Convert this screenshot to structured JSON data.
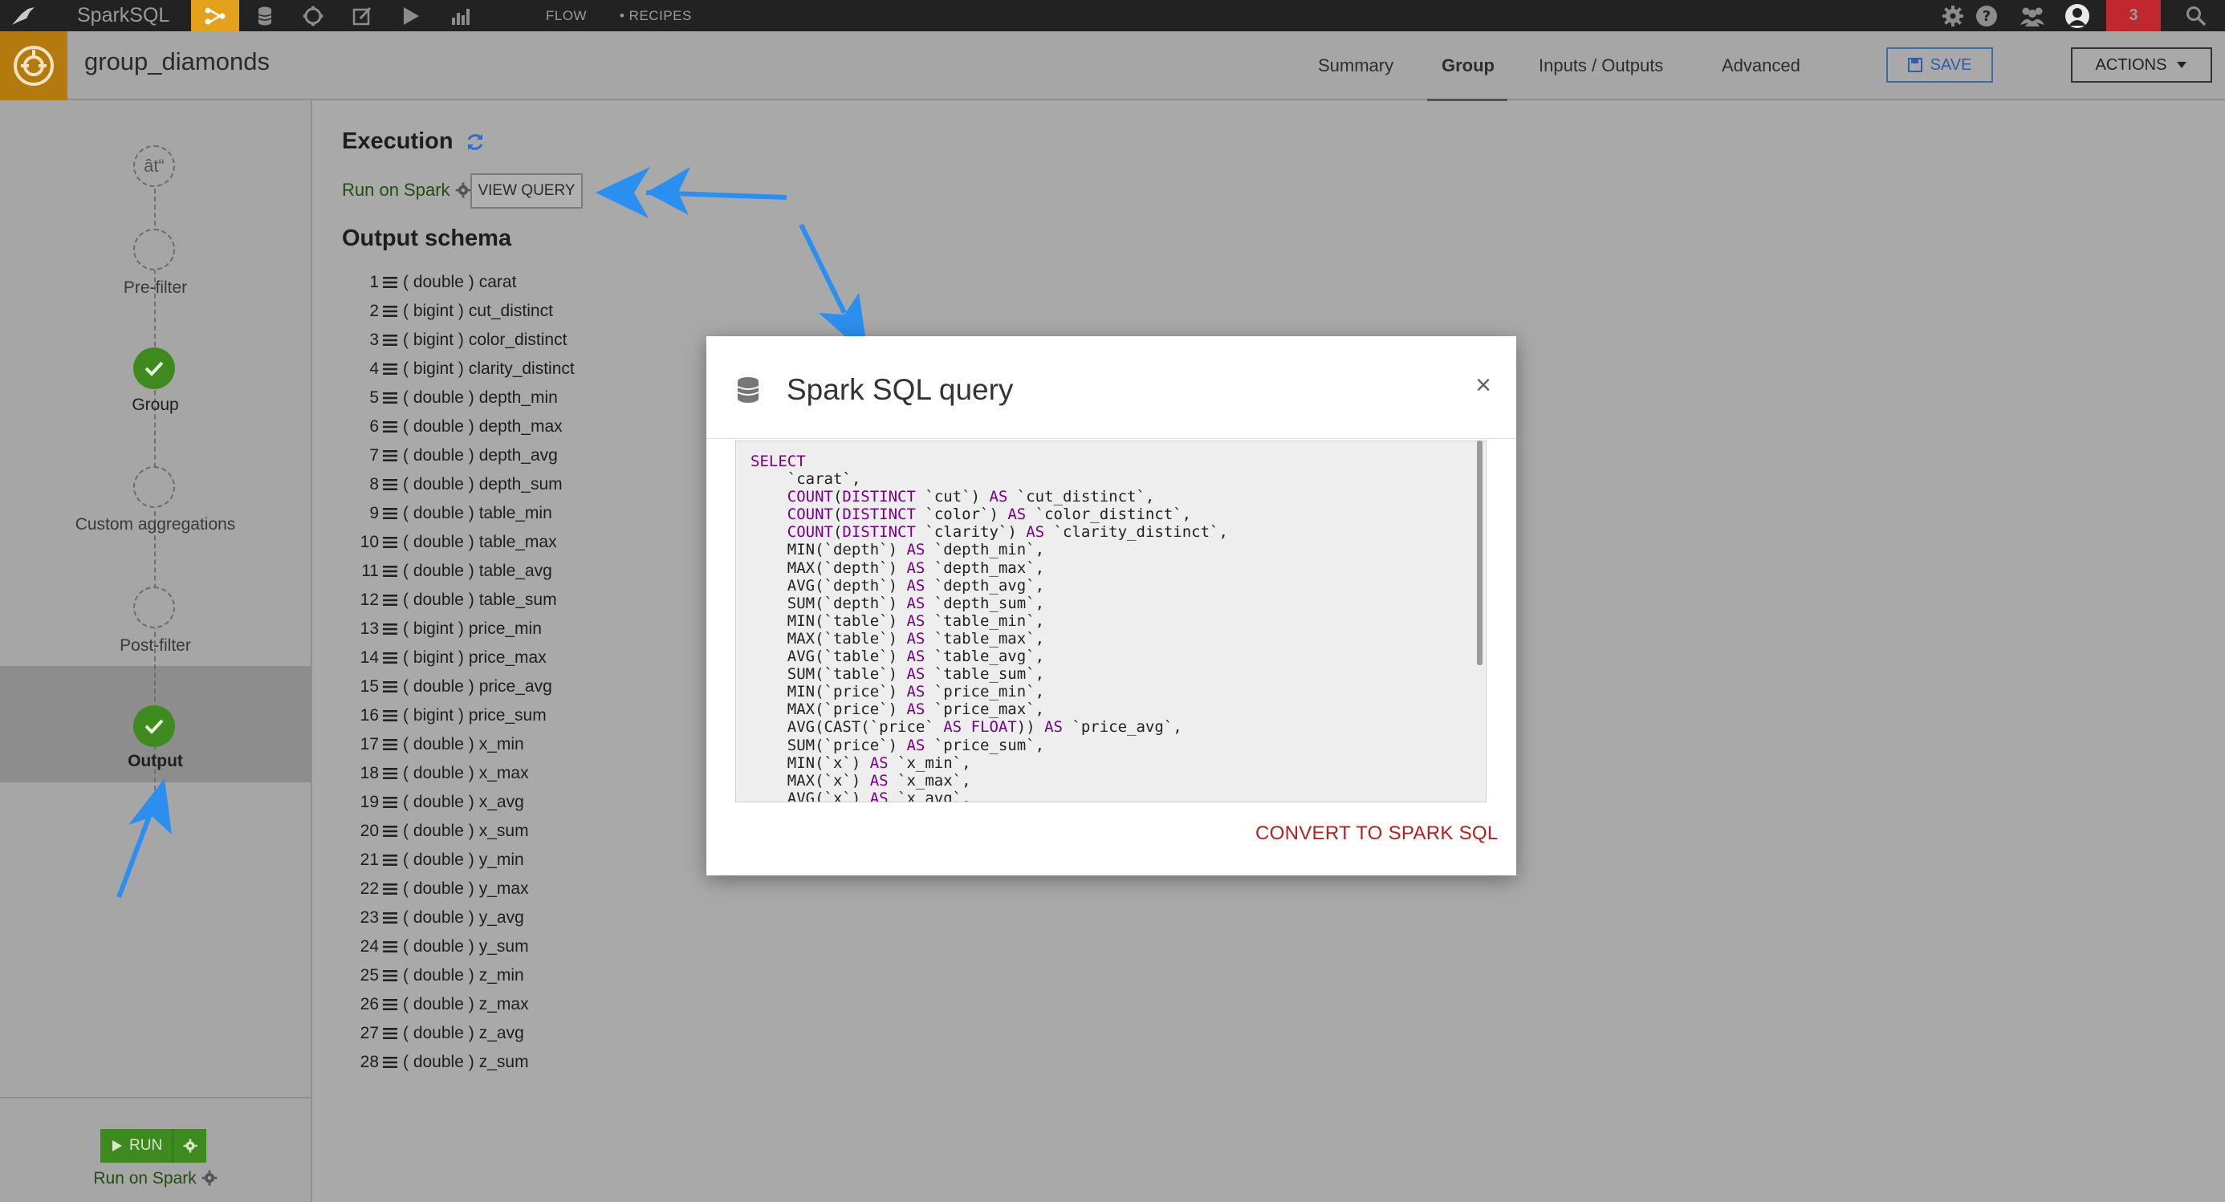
{
  "topbar": {
    "project_name": "SparkSQL",
    "flow_label": "FLOW",
    "recipes_label": "• RECIPES",
    "notification_count": "3"
  },
  "header": {
    "recipe_name": "group_diamonds",
    "tabs": [
      {
        "label": "Summary"
      },
      {
        "label": "Group",
        "active": true
      },
      {
        "label": "Inputs / Outputs"
      },
      {
        "label": "Advanced"
      }
    ],
    "save_label": "SAVE",
    "actions_label": "ACTIONS"
  },
  "sidebar": {
    "top_icon_glyph": "ât“",
    "steps": [
      {
        "label": "Pre-filter",
        "status": "empty"
      },
      {
        "label": "Group",
        "status": "done"
      },
      {
        "label": "Custom aggregations",
        "status": "empty"
      },
      {
        "label": "Post-filter",
        "status": "empty"
      },
      {
        "label": "Output",
        "status": "done",
        "selected": true
      }
    ],
    "run_label": "RUN",
    "engine_label": "Run on Spark"
  },
  "main": {
    "execution_title": "Execution",
    "engine_label": "Run on Spark",
    "view_query_label": "VIEW QUERY",
    "schema_title": "Output schema",
    "schema": [
      {
        "index": "1",
        "type": "( double )",
        "name": "carat"
      },
      {
        "index": "2",
        "type": "( bigint )",
        "name": "cut_distinct"
      },
      {
        "index": "3",
        "type": "( bigint )",
        "name": "color_distinct"
      },
      {
        "index": "4",
        "type": "( bigint )",
        "name": "clarity_distinct"
      },
      {
        "index": "5",
        "type": "( double )",
        "name": "depth_min"
      },
      {
        "index": "6",
        "type": "( double )",
        "name": "depth_max"
      },
      {
        "index": "7",
        "type": "( double )",
        "name": "depth_avg"
      },
      {
        "index": "8",
        "type": "( double )",
        "name": "depth_sum"
      },
      {
        "index": "9",
        "type": "( double )",
        "name": "table_min"
      },
      {
        "index": "10",
        "type": "( double )",
        "name": "table_max"
      },
      {
        "index": "11",
        "type": "( double )",
        "name": "table_avg"
      },
      {
        "index": "12",
        "type": "( double )",
        "name": "table_sum"
      },
      {
        "index": "13",
        "type": "( bigint )",
        "name": "price_min"
      },
      {
        "index": "14",
        "type": "( bigint )",
        "name": "price_max"
      },
      {
        "index": "15",
        "type": "( double )",
        "name": "price_avg"
      },
      {
        "index": "16",
        "type": "( bigint )",
        "name": "price_sum"
      },
      {
        "index": "17",
        "type": "( double )",
        "name": "x_min"
      },
      {
        "index": "18",
        "type": "( double )",
        "name": "x_max"
      },
      {
        "index": "19",
        "type": "( double )",
        "name": "x_avg"
      },
      {
        "index": "20",
        "type": "( double )",
        "name": "x_sum"
      },
      {
        "index": "21",
        "type": "( double )",
        "name": "y_min"
      },
      {
        "index": "22",
        "type": "( double )",
        "name": "y_max"
      },
      {
        "index": "23",
        "type": "( double )",
        "name": "y_avg"
      },
      {
        "index": "24",
        "type": "( double )",
        "name": "y_sum"
      },
      {
        "index": "25",
        "type": "( double )",
        "name": "z_min"
      },
      {
        "index": "26",
        "type": "( double )",
        "name": "z_max"
      },
      {
        "index": "27",
        "type": "( double )",
        "name": "z_avg"
      },
      {
        "index": "28",
        "type": "( double )",
        "name": "z_sum"
      }
    ]
  },
  "modal": {
    "title": "Spark SQL query",
    "close_glyph": "×",
    "convert_label": "CONVERT TO SPARK SQL",
    "code_lines": [
      "SELECT",
      "    `carat`,",
      "    COUNT(DISTINCT `cut`) AS `cut_distinct`,",
      "    COUNT(DISTINCT `color`) AS `color_distinct`,",
      "    COUNT(DISTINCT `clarity`) AS `clarity_distinct`,",
      "    MIN(`depth`) AS `depth_min`,",
      "    MAX(`depth`) AS `depth_max`,",
      "    AVG(`depth`) AS `depth_avg`,",
      "    SUM(`depth`) AS `depth_sum`,",
      "    MIN(`table`) AS `table_min`,",
      "    MAX(`table`) AS `table_max`,",
      "    AVG(`table`) AS `table_avg`,",
      "    SUM(`table`) AS `table_sum`,",
      "    MIN(`price`) AS `price_min`,",
      "    MAX(`price`) AS `price_max`,",
      "    AVG(CAST(`price` AS FLOAT)) AS `price_avg`,",
      "    SUM(`price`) AS `price_sum`,",
      "    MIN(`x`) AS `x_min`,",
      "    MAX(`x`) AS `x_max`,",
      "    AVG(`x`) AS `x_avg`,"
    ]
  },
  "colors": {
    "topbar": "#222222",
    "accent_orange": "#e3a11c",
    "success_green": "#3f8a1f",
    "link_blue": "#2d5fa8",
    "danger_red": "#b8201e",
    "keyword_purple": "#770088",
    "annotation_arrow": "#2b8ff0"
  }
}
